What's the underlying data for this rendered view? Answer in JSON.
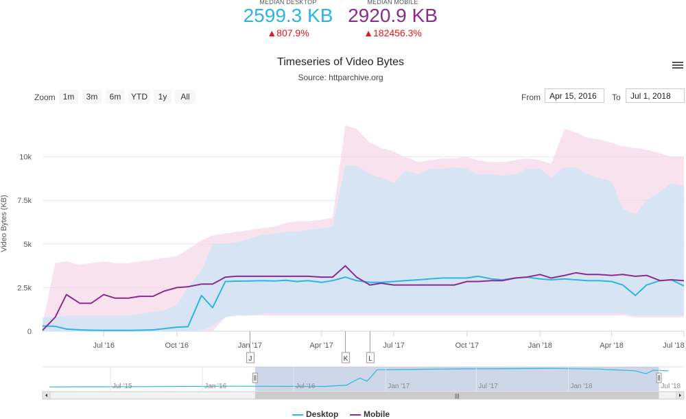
{
  "stats": {
    "desktop": {
      "label": "MEDIAN DESKTOP",
      "value": "2599.3 KB",
      "change": "▲807.9%",
      "color": "#29b6e3"
    },
    "mobile": {
      "label": "MEDIAN MOBILE",
      "value": "2920.9 KB",
      "change": "▲182456.3%",
      "color": "#8b2a8f"
    }
  },
  "menu_icon": "hamburger-menu-icon",
  "zoom": {
    "label": "Zoom",
    "buttons": [
      "1m",
      "3m",
      "6m",
      "YTD",
      "1y",
      "All"
    ]
  },
  "range": {
    "from_label": "From",
    "from_value": "Apr 15, 2016",
    "to_label": "To",
    "to_value": "Jul 1, 2018"
  },
  "legend": [
    {
      "name": "Desktop",
      "color": "#29b6e3"
    },
    {
      "name": "Mobile",
      "color": "#8b2a8f"
    }
  ],
  "flags": [
    "J",
    "K",
    "L"
  ],
  "navigator": {
    "x_ticks": [
      "Jul '15",
      "Jan '16",
      "Jul '16",
      "Jan '17",
      "Jul '17",
      "Jan '18",
      "Jul '18"
    ],
    "scroll_grip": "|||"
  },
  "chart_data": {
    "type": "line",
    "title": "Timeseries of Video Bytes",
    "subtitle": "Source: httparchive.org",
    "ylabel": "Video Bytes (KB)",
    "xlabel": "",
    "ylim": [
      0,
      12500
    ],
    "y_ticks": [
      "0",
      "2.5k",
      "5k",
      "7.5k",
      "10k"
    ],
    "x_ticks": [
      "Jul '16",
      "Oct '16",
      "Jan '17",
      "Apr '17",
      "Jul '17",
      "Oct '17",
      "Jan '18",
      "Apr '18",
      "Jul '18"
    ],
    "grid": true,
    "legend_position": "bottom",
    "x": [
      "2016-04-15",
      "2016-05-01",
      "2016-05-15",
      "2016-06-01",
      "2016-06-15",
      "2016-07-01",
      "2016-07-15",
      "2016-08-01",
      "2016-08-15",
      "2016-09-01",
      "2016-09-15",
      "2016-10-01",
      "2016-10-15",
      "2016-11-01",
      "2016-11-15",
      "2016-12-01",
      "2016-12-15",
      "2017-01-01",
      "2017-01-15",
      "2017-02-01",
      "2017-02-15",
      "2017-03-01",
      "2017-03-15",
      "2017-04-01",
      "2017-04-15",
      "2017-05-01",
      "2017-05-15",
      "2017-06-01",
      "2017-06-15",
      "2017-07-01",
      "2017-07-15",
      "2017-08-01",
      "2017-08-15",
      "2017-09-01",
      "2017-09-15",
      "2017-10-01",
      "2017-10-15",
      "2017-11-01",
      "2017-11-15",
      "2017-12-01",
      "2017-12-15",
      "2018-01-01",
      "2018-01-15",
      "2018-02-01",
      "2018-02-15",
      "2018-03-01",
      "2018-03-15",
      "2018-04-01",
      "2018-04-15",
      "2018-05-01",
      "2018-05-15",
      "2018-06-01",
      "2018-06-15",
      "2018-07-01"
    ],
    "series": [
      {
        "name": "Desktop",
        "color": "#29b6e3",
        "values": [
          300,
          280,
          120,
          80,
          60,
          50,
          50,
          50,
          60,
          80,
          150,
          230,
          260,
          2050,
          1350,
          2850,
          2870,
          2880,
          2900,
          2880,
          2920,
          2850,
          2900,
          2800,
          2900,
          3100,
          2900,
          2800,
          2800,
          2850,
          2900,
          2950,
          3000,
          3050,
          3050,
          3050,
          3150,
          3000,
          2950,
          3050,
          3100,
          3000,
          2950,
          3000,
          2950,
          2900,
          2900,
          2850,
          2650,
          2050,
          2650,
          2900,
          2950,
          2600
        ]
      },
      {
        "name": "Mobile",
        "color": "#8b2a8f",
        "values": [
          50,
          800,
          2100,
          1600,
          1600,
          2100,
          1900,
          1900,
          2000,
          2000,
          2300,
          2500,
          2550,
          2700,
          2700,
          3100,
          3150,
          3150,
          3150,
          3150,
          3150,
          3150,
          3150,
          3100,
          3100,
          3750,
          3100,
          2650,
          2750,
          2650,
          2650,
          2650,
          2650,
          2650,
          2650,
          2850,
          2850,
          2900,
          2900,
          3050,
          3100,
          3250,
          3050,
          3200,
          3350,
          3250,
          3250,
          3200,
          3250,
          3150,
          3200,
          2900,
          2950,
          2900
        ]
      }
    ],
    "bands": [
      {
        "name": "Desktop range",
        "color": "#c9e6f5",
        "low": [
          0,
          0,
          0,
          0,
          0,
          0,
          0,
          0,
          0,
          0,
          0,
          0,
          0,
          50,
          300,
          800,
          900,
          900,
          1000,
          1000,
          1000,
          1000,
          1000,
          1000,
          1000,
          1000,
          1000,
          1000,
          1000,
          1000,
          1000,
          1000,
          1000,
          1000,
          1000,
          1000,
          1000,
          1000,
          1000,
          1000,
          1000,
          1000,
          1000,
          1000,
          1000,
          1000,
          1000,
          1000,
          1000,
          900,
          900,
          900,
          900,
          900
        ],
        "high": [
          800,
          800,
          900,
          900,
          900,
          900,
          900,
          900,
          1000,
          1100,
          1200,
          1500,
          2500,
          3500,
          5000,
          5000,
          5100,
          5300,
          5500,
          5600,
          5700,
          5700,
          5800,
          5900,
          6000,
          9500,
          9500,
          9000,
          8800,
          8500,
          9200,
          9000,
          9300,
          9300,
          9400,
          9300,
          9000,
          9000,
          8900,
          9000,
          9300,
          9300,
          8800,
          9400,
          9400,
          9000,
          8800,
          8600,
          7000,
          6700,
          7500,
          8000,
          8500,
          8300
        ]
      },
      {
        "name": "Mobile range",
        "color": "#f5d6e6",
        "low": [
          0,
          0,
          0,
          0,
          0,
          0,
          0,
          0,
          0,
          0,
          0,
          0,
          0,
          0,
          0,
          800,
          900,
          900,
          900,
          900,
          900,
          900,
          900,
          900,
          900,
          900,
          900,
          900,
          900,
          900,
          900,
          900,
          900,
          900,
          900,
          900,
          900,
          900,
          900,
          900,
          900,
          900,
          900,
          900,
          900,
          900,
          900,
          900,
          900,
          800,
          800,
          800,
          800,
          800
        ],
        "high": [
          400,
          3900,
          4000,
          3800,
          3900,
          4000,
          3900,
          3900,
          4000,
          4100,
          4200,
          4300,
          4700,
          5200,
          5500,
          5600,
          5700,
          5800,
          5900,
          6000,
          6200,
          6300,
          6300,
          6400,
          6500,
          11800,
          11600,
          10800,
          10500,
          10300,
          10000,
          9700,
          9800,
          9900,
          9900,
          10000,
          9800,
          9700,
          9700,
          9800,
          9900,
          9800,
          9600,
          11600,
          11400,
          11100,
          11000,
          10800,
          10600,
          10500,
          10400,
          10200,
          10000,
          10000
        ]
      }
    ]
  }
}
